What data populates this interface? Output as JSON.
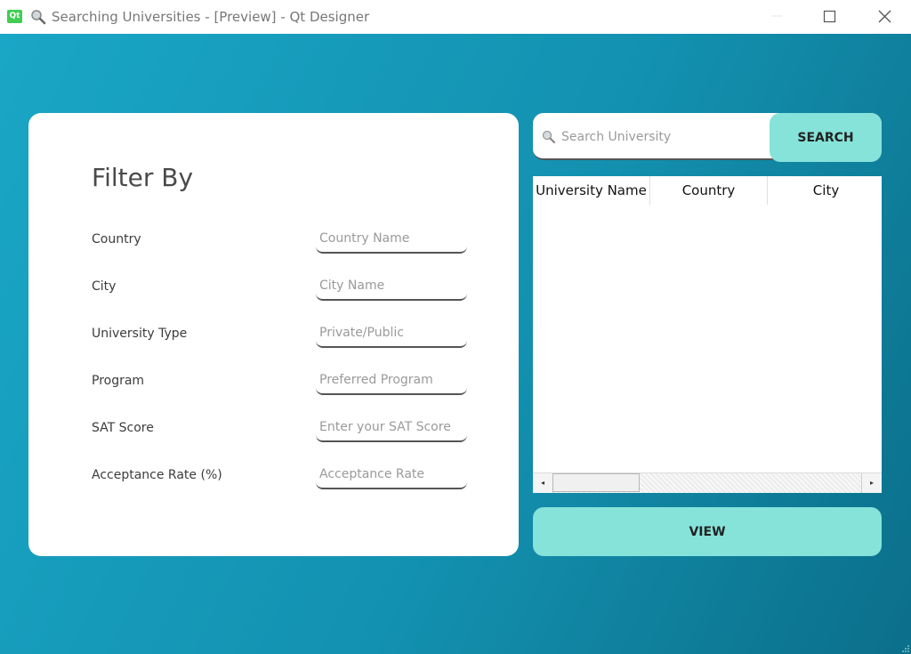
{
  "window": {
    "title": "Searching Universities - [Preview] - Qt Designer",
    "app_icon_text": "Qt"
  },
  "filter": {
    "title": "Filter By",
    "fields": [
      {
        "label": "Country",
        "placeholder": "Country Name"
      },
      {
        "label": "City",
        "placeholder": "City Name"
      },
      {
        "label": "University Type",
        "placeholder": "Private/Public"
      },
      {
        "label": "Program",
        "placeholder": "Preferred Program"
      },
      {
        "label": "SAT Score",
        "placeholder": "Enter your SAT Score"
      },
      {
        "label": "Acceptance Rate (%)",
        "placeholder": "Acceptance Rate"
      }
    ]
  },
  "search": {
    "placeholder": "Search University",
    "button_label": "SEARCH"
  },
  "table": {
    "columns": [
      "University Name",
      "Country",
      "City"
    ],
    "rows": []
  },
  "view_button_label": "VIEW",
  "colors": {
    "accent": "#86e3da",
    "background": "#1391b0"
  }
}
